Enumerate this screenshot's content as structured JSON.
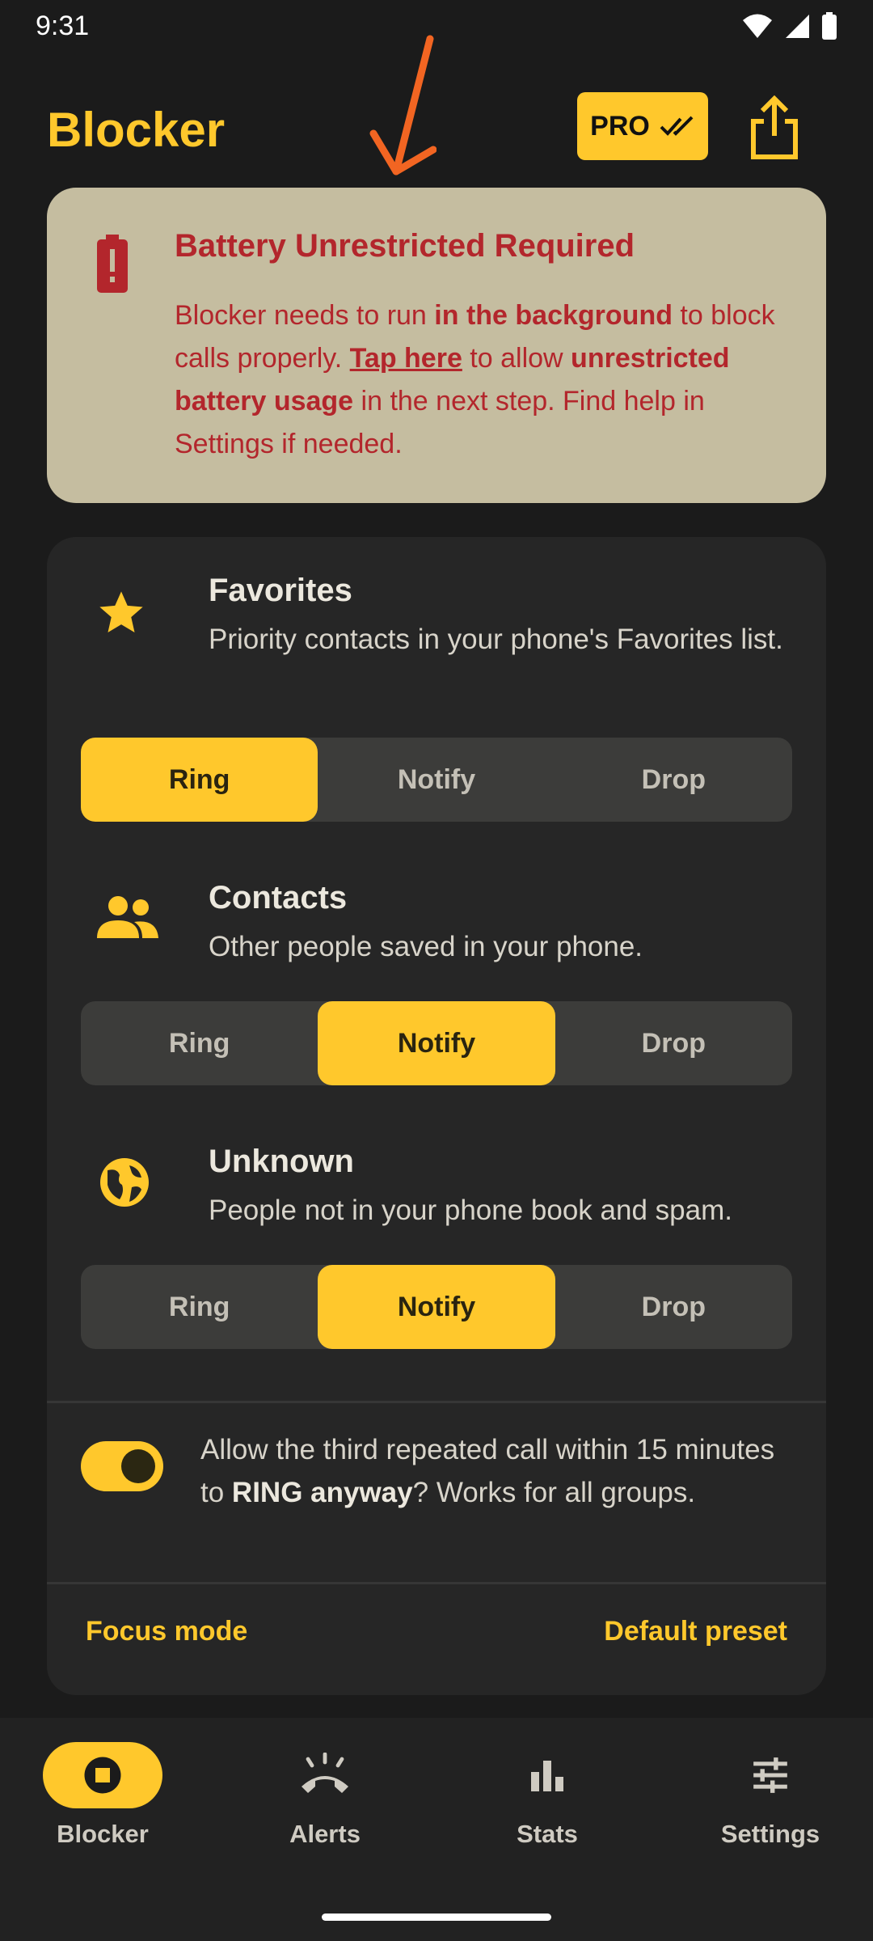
{
  "status": {
    "time": "9:31"
  },
  "header": {
    "title": "Blocker",
    "pro_label": "PRO"
  },
  "warning": {
    "title": "Battery Unrestricted Required",
    "t1": "Blocker needs to run ",
    "b1": "in the background",
    "t2": " to block calls properly. ",
    "link": "Tap here",
    "t3": " to allow ",
    "b2": "unrestricted battery usage",
    "t4": " in the next step. Find help in Settings if needed."
  },
  "groups": [
    {
      "name": "Favorites",
      "desc": "Priority contacts in your phone's Favorites list.",
      "selected": "Ring"
    },
    {
      "name": "Contacts",
      "desc": "Other people saved in your phone.",
      "selected": "Notify"
    },
    {
      "name": "Unknown",
      "desc": "People not in your phone book and spam.",
      "selected": "Notify"
    }
  ],
  "options": [
    "Ring",
    "Notify",
    "Drop"
  ],
  "repeat": {
    "enabled": true,
    "t1": "Allow the third repeated call within 15 minutes to ",
    "b1": "RING anyway",
    "t2": "? Works for all groups."
  },
  "footer": {
    "focus_mode": "Focus mode",
    "default_preset": "Default preset"
  },
  "nav": [
    {
      "label": "Blocker",
      "icon": "stop-circle-icon",
      "active": true
    },
    {
      "label": "Alerts",
      "icon": "call-end-icon",
      "active": false
    },
    {
      "label": "Stats",
      "icon": "bar-chart-icon",
      "active": false
    },
    {
      "label": "Settings",
      "icon": "tune-icon",
      "active": false
    }
  ],
  "colors": {
    "accent": "#ffc82c",
    "warning_bg": "#c5bda0",
    "warning_text": "#b3262c",
    "annotation": "#f26522"
  }
}
